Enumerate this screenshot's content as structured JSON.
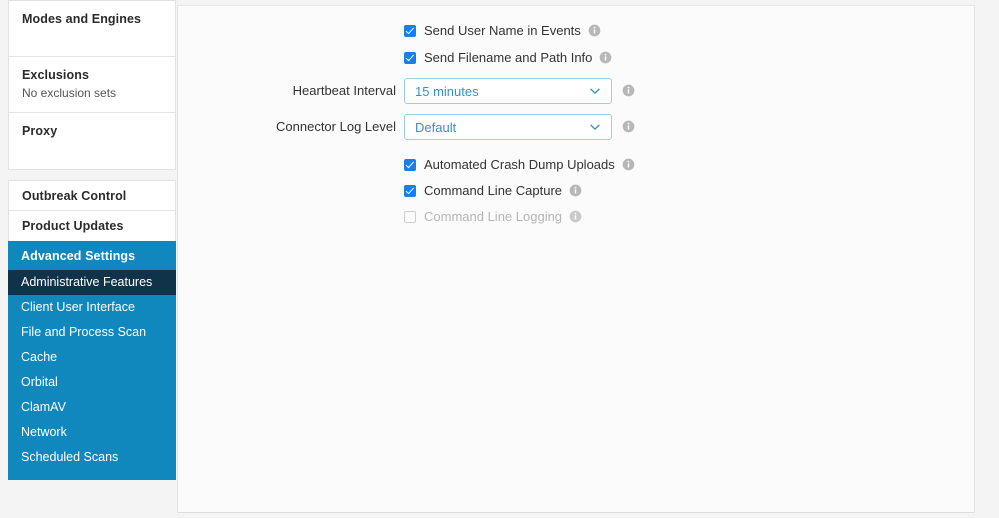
{
  "sidebar": {
    "groups": [
      {
        "cards": [
          {
            "title": "Modes and Engines",
            "subtitle": ""
          },
          {
            "title": "Exclusions",
            "subtitle": "No exclusion sets"
          },
          {
            "title": "Proxy",
            "subtitle": ""
          }
        ]
      },
      {
        "cards": [
          {
            "title": "Outbreak Control",
            "subtitle": ""
          },
          {
            "title": "Product Updates",
            "subtitle": ""
          }
        ]
      }
    ],
    "advanced": {
      "header": "Advanced Settings",
      "active_item": "Administrative Features",
      "items": [
        "Administrative Features",
        "Client User Interface",
        "File and Process Scan",
        "Cache",
        "Orbital",
        "ClamAV",
        "Network",
        "Scheduled Scans"
      ]
    }
  },
  "main": {
    "checkboxes_top": [
      {
        "label": "Send User Name in Events",
        "checked": true,
        "disabled": false
      },
      {
        "label": "Send Filename and Path Info",
        "checked": true,
        "disabled": false
      }
    ],
    "selects": [
      {
        "label": "Heartbeat Interval",
        "value": "15 minutes"
      },
      {
        "label": "Connector Log Level",
        "value": "Default"
      }
    ],
    "checkboxes_bottom": [
      {
        "label": "Automated Crash Dump Uploads",
        "checked": true,
        "disabled": false
      },
      {
        "label": "Command Line Capture",
        "checked": true,
        "disabled": false
      },
      {
        "label": "Command Line Logging",
        "checked": false,
        "disabled": true
      }
    ]
  },
  "colors": {
    "accent_blue": "#1088bd",
    "active_navy": "#11334a",
    "checkbox_blue": "#1a7ee8",
    "select_text": "#3592c4",
    "select_border": "#9dd0e8",
    "info_gray": "#b7b7b7",
    "page_bg": "#f4f4f4",
    "panel_bg": "#fbfbfb"
  },
  "icons": {
    "info": "info-icon",
    "chevron": "chevron-down-icon",
    "check": "checkmark-icon"
  }
}
